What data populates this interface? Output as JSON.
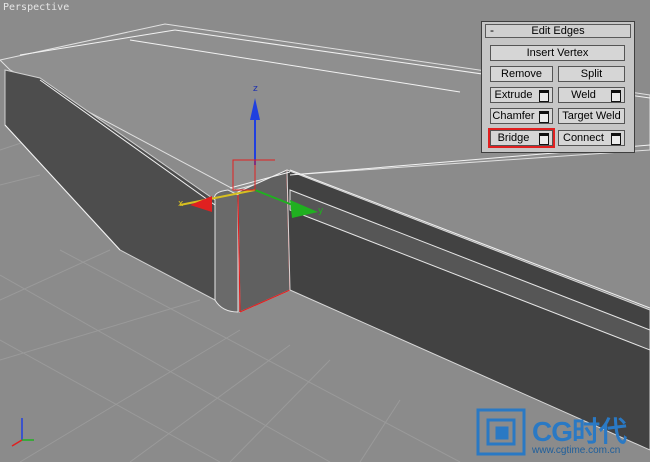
{
  "viewport": {
    "label": "Perspective"
  },
  "panel": {
    "collapse_toggle": "-",
    "title": "Edit Edges",
    "buttons": {
      "insert_vertex": "Insert Vertex",
      "remove": "Remove",
      "split": "Split",
      "extrude": "Extrude",
      "weld": "Weld",
      "chamfer": "Chamfer",
      "target_weld": "Target Weld",
      "bridge": "Bridge",
      "connect": "Connect"
    }
  },
  "gizmo": {
    "z": "z",
    "x": "x",
    "y": "y"
  },
  "logo": {
    "text": "CG时代",
    "url": "www.cgtime.com.cn"
  },
  "colors": {
    "viewport_bg": "#8b8b8b",
    "panel_bg": "#c6c6c6",
    "highlight": "#e02020",
    "axis_x": "#e02020",
    "axis_y": "#20b020",
    "axis_z": "#2040e0",
    "logo": "#2a79c4"
  }
}
